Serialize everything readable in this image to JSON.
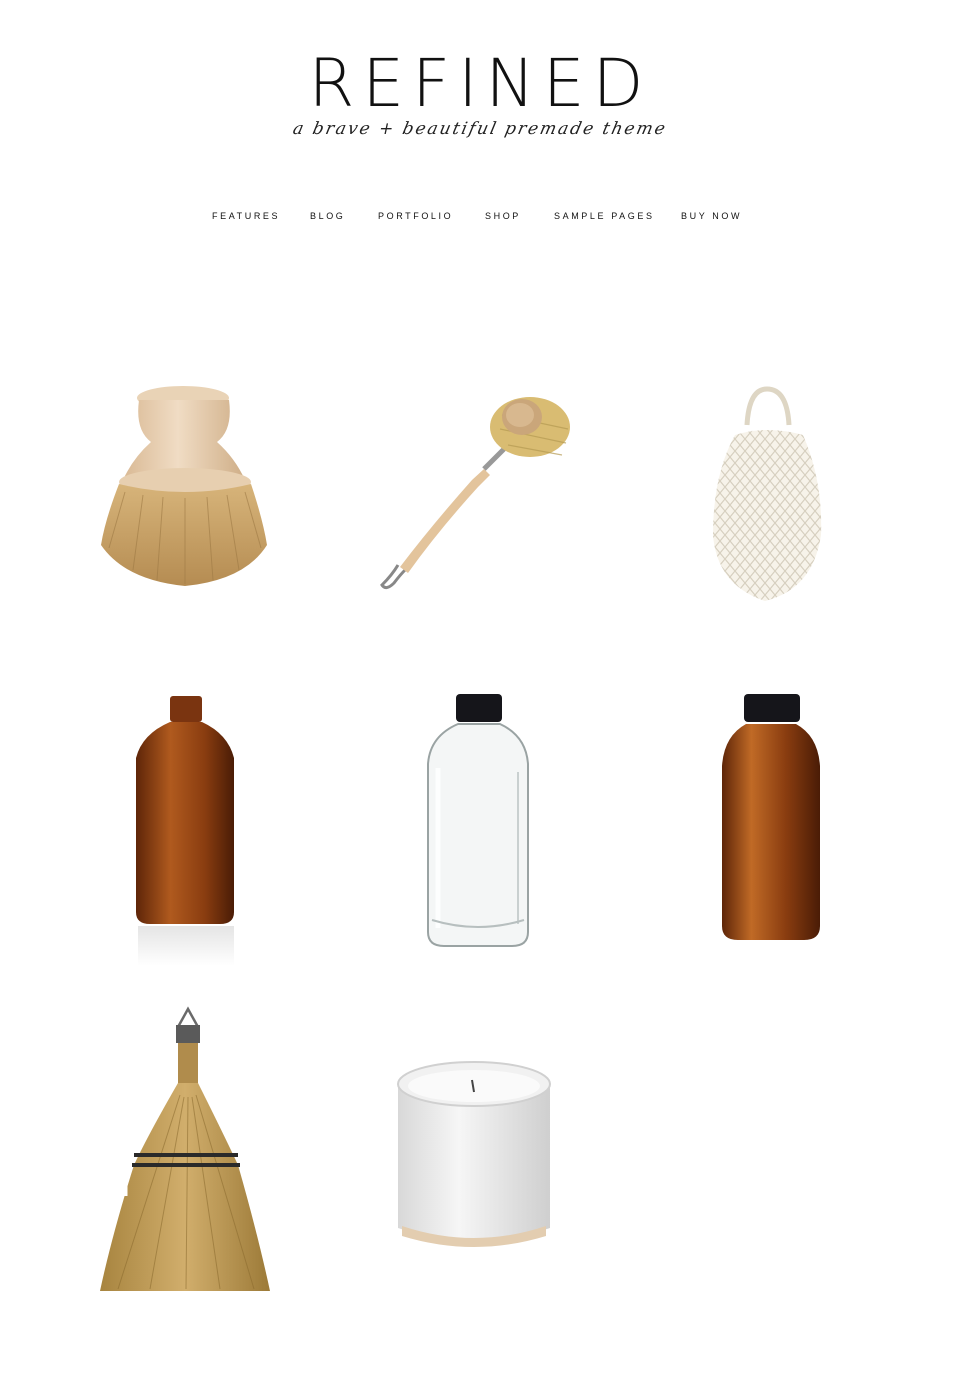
{
  "site": {
    "title": "REFINED",
    "tagline": "a brave + beautiful premade theme"
  },
  "nav": {
    "items": [
      {
        "label": "FEATURES"
      },
      {
        "label": "BLOG"
      },
      {
        "label": "PORTFOLIO"
      },
      {
        "label": "SHOP"
      },
      {
        "label": "SAMPLE PAGES"
      },
      {
        "label": "BUY NOW"
      }
    ]
  },
  "products": [
    {
      "name": "pot-scrubber-brush-image",
      "icon": "wooden-pot-brush"
    },
    {
      "name": "dish-brush-image",
      "icon": "long-handle-dish-brush"
    },
    {
      "name": "mesh-bag-image",
      "icon": "cotton-mesh-market-bag"
    },
    {
      "name": "amber-bottle-image",
      "icon": "amber-glass-bottle"
    },
    {
      "name": "clear-bottle-image",
      "icon": "clear-glass-bottle-black-cap"
    },
    {
      "name": "amber-bottle-cap-image",
      "icon": "amber-glass-bottle-black-cap"
    },
    {
      "name": "whisk-broom-image",
      "icon": "straw-whisk-broom"
    },
    {
      "name": "candle-image",
      "icon": "white-ceramic-candle"
    }
  ],
  "colors": {
    "amber": "#8a3d10",
    "wood": "#e6c9a4",
    "bristle": "#c9a56c",
    "straw": "#bf9a55",
    "cap": "#15151a"
  }
}
